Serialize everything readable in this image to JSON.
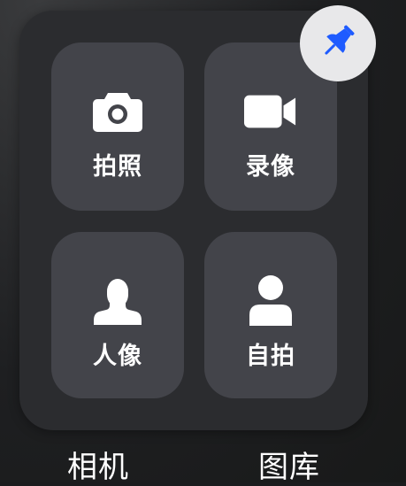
{
  "panel": {
    "tiles": [
      {
        "label": "拍照",
        "icon": "camera-icon"
      },
      {
        "label": "录像",
        "icon": "video-camera-icon"
      },
      {
        "label": "人像",
        "icon": "portrait-person-icon"
      },
      {
        "label": "自拍",
        "icon": "selfie-person-icon"
      }
    ],
    "pin": {
      "icon": "pushpin-icon",
      "color": "#1e5bff"
    }
  },
  "apps": {
    "camera_label": "相机",
    "gallery_label": "图库"
  },
  "colors": {
    "tile_bg": "#43444a",
    "panel_bg": "#2b2c2f",
    "pin_bg": "#e8e8ea",
    "accent": "#1e5bff"
  }
}
